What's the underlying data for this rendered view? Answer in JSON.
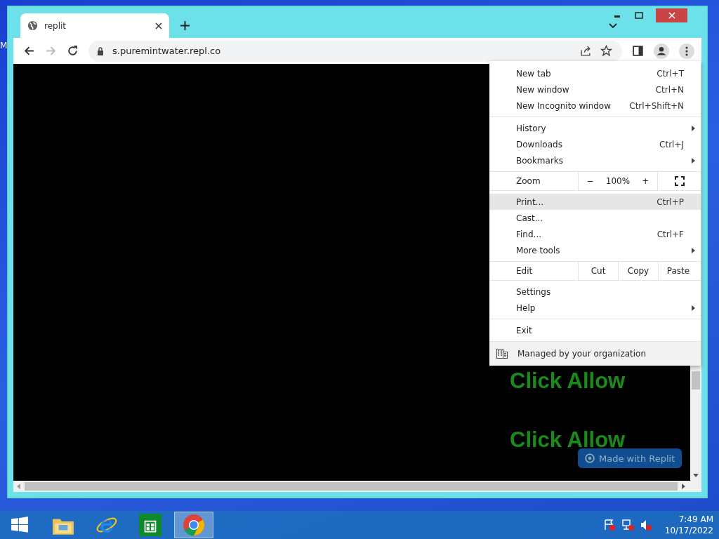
{
  "desktop": {
    "icon_label": "M"
  },
  "browser": {
    "tab": {
      "title": "replit"
    },
    "address": "s.puremintwater.repl.co"
  },
  "page": {
    "texts": [
      "Click Allow",
      "Click Allow"
    ],
    "badge": "Made with Replit"
  },
  "menu": {
    "sections": [
      [
        {
          "kind": "item",
          "label": "New tab",
          "shortcut": "Ctrl+T",
          "submenu": false,
          "highlighted": false
        },
        {
          "kind": "item",
          "label": "New window",
          "shortcut": "Ctrl+N",
          "submenu": false,
          "highlighted": false
        },
        {
          "kind": "item",
          "label": "New Incognito window",
          "shortcut": "Ctrl+Shift+N",
          "submenu": false,
          "highlighted": false
        }
      ],
      [
        {
          "kind": "item",
          "label": "History",
          "submenu": true,
          "highlighted": false
        },
        {
          "kind": "item",
          "label": "Downloads",
          "shortcut": "Ctrl+J",
          "submenu": false,
          "highlighted": false
        },
        {
          "kind": "item",
          "label": "Bookmarks",
          "submenu": true,
          "highlighted": false
        }
      ],
      [
        {
          "kind": "zoom",
          "label": "Zoom",
          "minus": "−",
          "value": "100%",
          "plus": "+"
        }
      ],
      [
        {
          "kind": "item",
          "label": "Print...",
          "shortcut": "Ctrl+P",
          "submenu": false,
          "highlighted": true
        },
        {
          "kind": "item",
          "label": "Cast...",
          "submenu": false,
          "highlighted": false
        },
        {
          "kind": "item",
          "label": "Find...",
          "shortcut": "Ctrl+F",
          "submenu": false,
          "highlighted": false
        },
        {
          "kind": "item",
          "label": "More tools",
          "submenu": true,
          "highlighted": false
        }
      ],
      [
        {
          "kind": "edit",
          "label": "Edit",
          "actions": [
            "Cut",
            "Copy",
            "Paste"
          ]
        }
      ],
      [
        {
          "kind": "item",
          "label": "Settings",
          "submenu": false,
          "highlighted": false
        },
        {
          "kind": "item",
          "label": "Help",
          "submenu": true,
          "highlighted": false
        }
      ],
      [
        {
          "kind": "item",
          "label": "Exit",
          "submenu": false,
          "highlighted": false
        }
      ],
      [
        {
          "kind": "managed",
          "label": "Managed by your organization"
        }
      ]
    ]
  },
  "taskbar": {
    "apps": [
      {
        "kind": "start",
        "selected": false
      },
      {
        "kind": "files",
        "selected": false
      },
      {
        "kind": "ie",
        "selected": false
      },
      {
        "kind": "store",
        "selected": false
      },
      {
        "kind": "chrome",
        "selected": true
      }
    ],
    "clock": {
      "time": "7:49 AM",
      "date": "10/17/2022"
    }
  }
}
